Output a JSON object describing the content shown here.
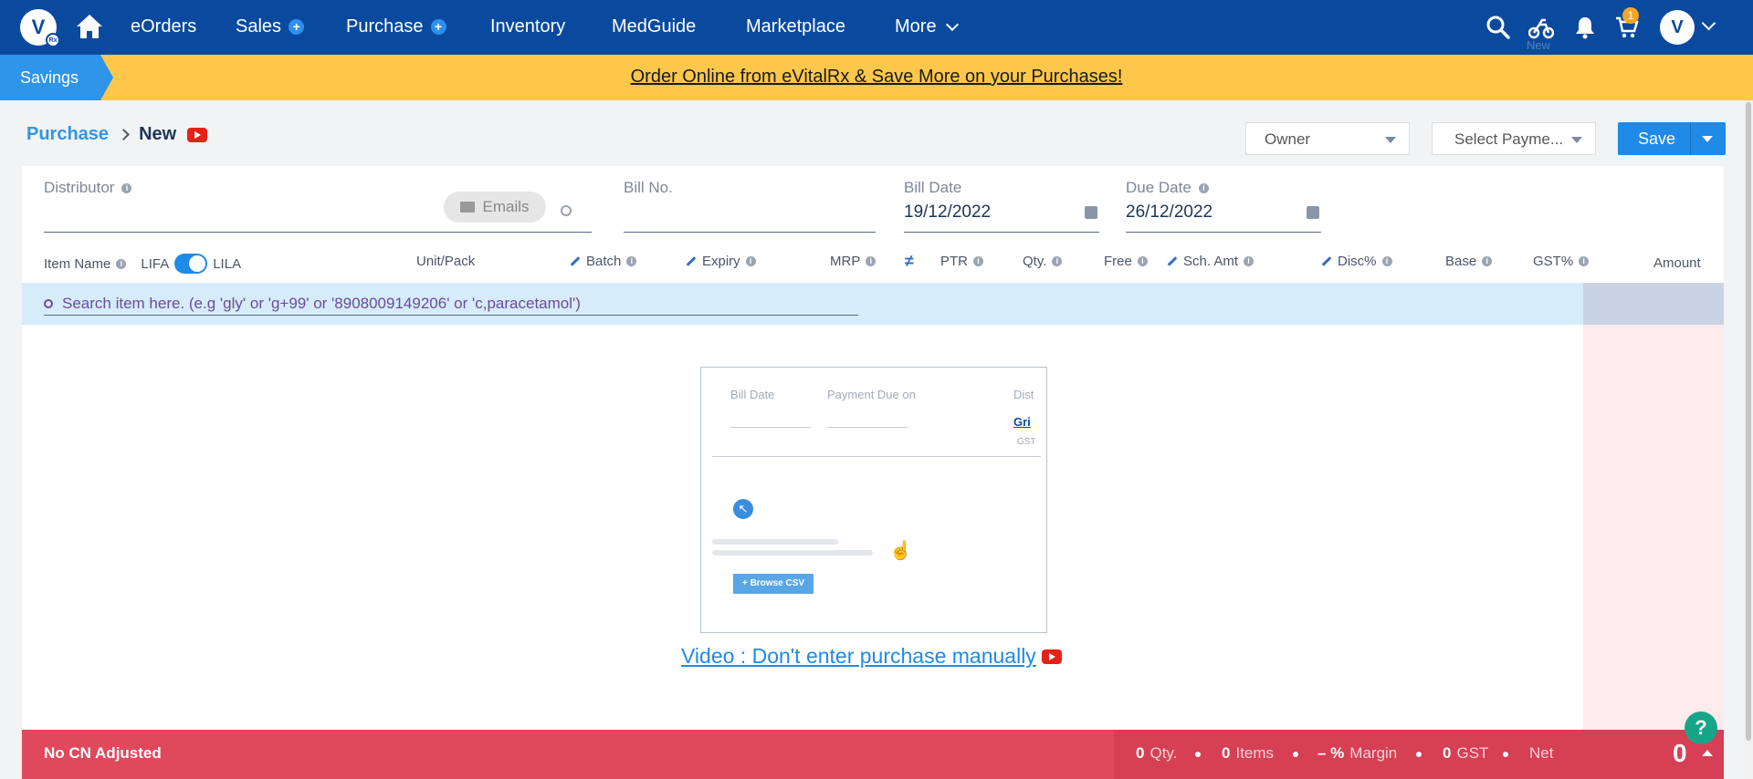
{
  "nav": {
    "logo_letter": "V",
    "logo_badge": "Rx",
    "items": [
      {
        "label": "eOrders",
        "has_plus": false
      },
      {
        "label": "Sales",
        "has_plus": true
      },
      {
        "label": "Purchase",
        "has_plus": true
      },
      {
        "label": "Inventory",
        "has_plus": false
      },
      {
        "label": "MedGuide",
        "has_plus": false
      },
      {
        "label": "Marketplace",
        "has_plus": false
      }
    ],
    "more_label": "More",
    "cart_count": "1",
    "new_label": "New",
    "avatar_letter": "V"
  },
  "banner": {
    "savings_label": "Savings",
    "text": "Order Online from eVitalRx & Save More on your Purchases!"
  },
  "header": {
    "breadcrumb_root": "Purchase",
    "breadcrumb_current": "New",
    "owner_select": "Owner",
    "payment_select": "Select Payme...",
    "save_label": "Save"
  },
  "form": {
    "distributor_label": "Distributor",
    "emails_label": "Emails",
    "bill_no_label": "Bill No.",
    "bill_date_label": "Bill Date",
    "bill_date_value": "19/12/2022",
    "due_date_label": "Due Date",
    "due_date_value": "26/12/2022"
  },
  "table": {
    "columns": {
      "item_name": "Item Name",
      "lifa": "LIFA",
      "lila": "LILA",
      "unit_pack": "Unit/Pack",
      "batch": "Batch",
      "expiry": "Expiry",
      "mrp": "MRP",
      "ptr": "PTR",
      "qty": "Qty.",
      "free": "Free",
      "sch_amt": "Sch. Amt",
      "disc": "Disc%",
      "base": "Base",
      "gst": "GST%",
      "amount": "Amount"
    },
    "search_placeholder": "Search item here. (e.g 'gly' or 'g+99' or '8908009149206' or 'c,paracetamol')"
  },
  "video": {
    "thumb_bill_date": "Bill Date",
    "thumb_payment_due": "Payment Due on",
    "thumb_dist": "Dist",
    "thumb_link": "Gri",
    "thumb_gst": "GST",
    "thumb_browse": "+ Browse CSV",
    "link_text": "Video : Don't enter purchase manually "
  },
  "footer": {
    "cn_label": "No CN Adjusted",
    "qty_value": "0",
    "qty_label": "Qty.",
    "items_value": "0",
    "items_label": "Items",
    "margin_value": "– %",
    "margin_label": "Margin",
    "gst_value": "0",
    "gst_label": "GST",
    "net_label": "Net",
    "net_value": "0"
  },
  "help_label": "?"
}
